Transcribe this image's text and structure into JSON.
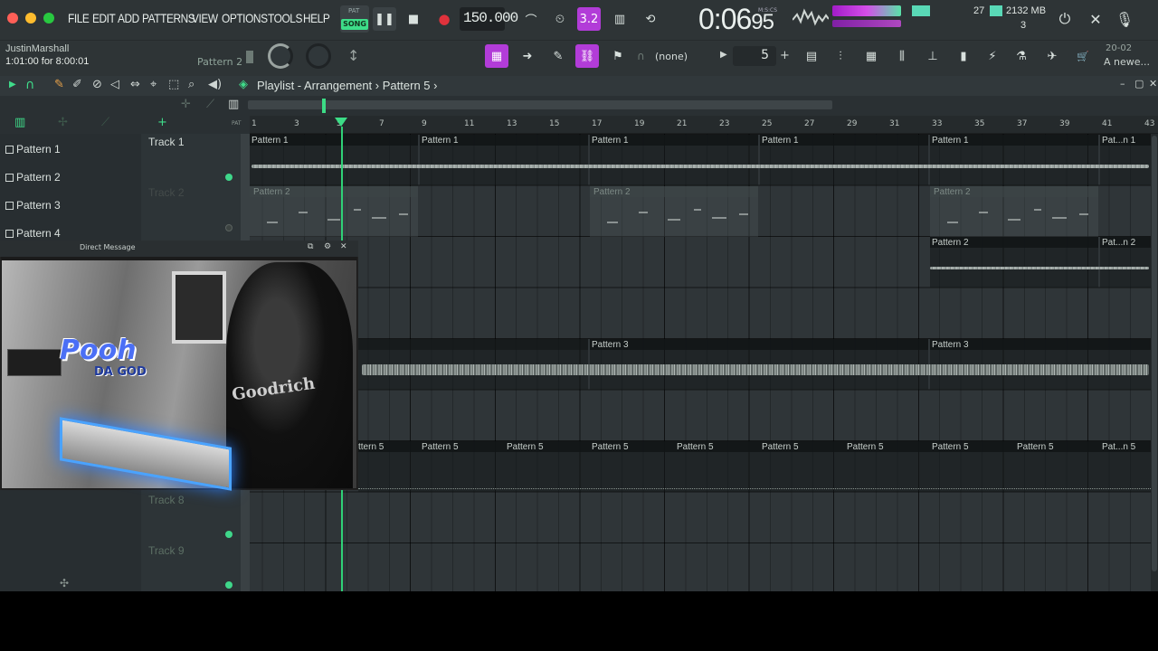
{
  "menu": [
    "FILE",
    "EDIT",
    "ADD",
    "PATTERNS",
    "VIEW",
    "OPTIONS",
    "TOOLS",
    "HELP"
  ],
  "transport": {
    "mode_pat": "PAT",
    "mode_song": "SONG",
    "tempo": "150.000",
    "time": "0:06",
    "time_frac": "95",
    "time_unit": "M:S:CS"
  },
  "stats": {
    "voices": "27",
    "memory": "2132 MB",
    "cpu": "3"
  },
  "hint": {
    "user": "JustinMarshall",
    "time": "1:01:00 for 8:00:01"
  },
  "pattern_selector": "Pattern 2",
  "snap": {
    "label": "(none)",
    "value": "5"
  },
  "recent": {
    "date": "20-02",
    "name": "A newe..."
  },
  "playlist": {
    "title": "Playlist - Arrangement",
    "sep": "›",
    "current": "Pattern 5"
  },
  "ruler": [
    "1",
    "3",
    "5",
    "7",
    "9",
    "11",
    "13",
    "15",
    "17",
    "19",
    "21",
    "23",
    "25",
    "27",
    "29",
    "31",
    "33",
    "35",
    "37",
    "39",
    "41",
    "43"
  ],
  "picker": [
    "Pattern 1",
    "Pattern 2",
    "Pattern 3",
    "Pattern 4"
  ],
  "tracks": {
    "t1": "Track 1",
    "t2": "Track 2",
    "t8": "Track 8",
    "t9": "Track 9"
  },
  "clips": {
    "p1": "Pattern 1",
    "p1_trunc": "Pat...n 1",
    "p2": "Pattern 2",
    "p2_trunc": "Pat...n 2",
    "p3": "Pattern 3",
    "p5": "Pattern 5",
    "p5_partial": "ttern 5",
    "p5_trunc": "Pat...n 5"
  },
  "webcam": {
    "title": "Direct Message",
    "logo": "Pooh",
    "logo_sub": "DA GOD",
    "shirt": "Goodrich"
  },
  "colors": {
    "accent_green": "#3dde89",
    "accent_purple": "#b23cd8",
    "record_red": "#e0323c"
  }
}
